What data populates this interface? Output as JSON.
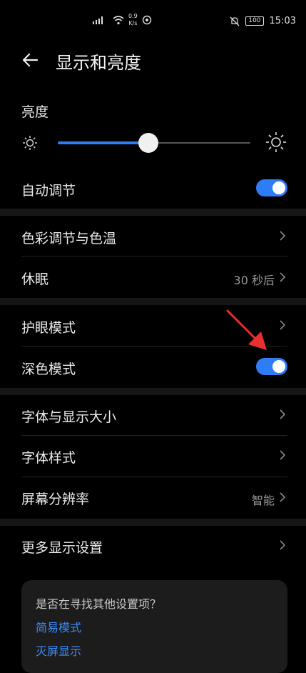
{
  "status_bar": {
    "speed_value": "0.9",
    "speed_unit": "K/s",
    "battery": "100",
    "time": "15:03"
  },
  "header": {
    "title": "显示和亮度"
  },
  "brightness": {
    "label": "亮度",
    "level_fraction": 0.47
  },
  "auto_adjust": {
    "label": "自动调节",
    "on": true
  },
  "color_temp": {
    "label": "色彩调节与色温"
  },
  "sleep": {
    "label": "休眠",
    "value": "30 秒后"
  },
  "eye_comfort": {
    "label": "护眼模式"
  },
  "dark_mode": {
    "label": "深色模式",
    "on": true
  },
  "font_size": {
    "label": "字体与显示大小"
  },
  "font_style": {
    "label": "字体样式"
  },
  "resolution": {
    "label": "屏幕分辨率",
    "value": "智能"
  },
  "more_display": {
    "label": "更多显示设置"
  },
  "suggestions": {
    "question": "是否在寻找其他设置项？",
    "link1": "简易模式",
    "link2": "灭屏显示"
  },
  "colors": {
    "accent": "#2f7df6",
    "annotation_arrow": "#e8302f"
  }
}
